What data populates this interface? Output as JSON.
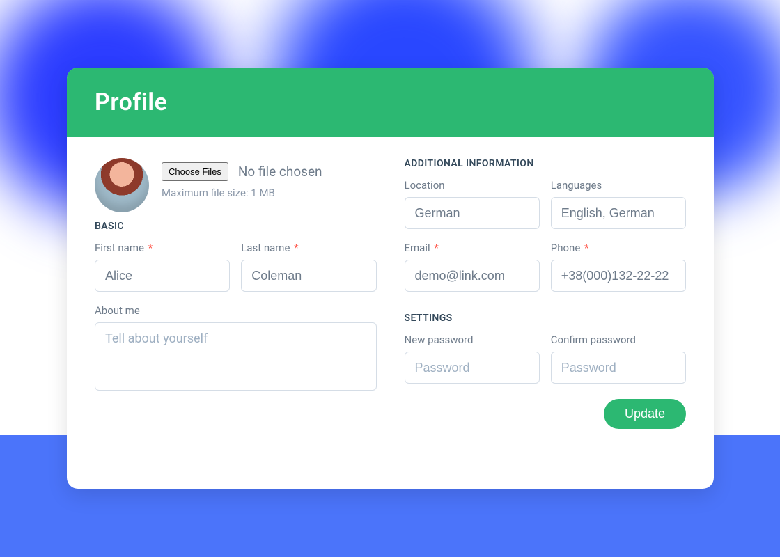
{
  "header": {
    "title": "Profile"
  },
  "avatar": {
    "choose_label": "Choose Files",
    "status": "No file chosen",
    "hint": "Maximum file size: 1 MB"
  },
  "sections": {
    "basic": "BASIC",
    "additional": "ADDITIONAL INFORMATION",
    "settings": "SETTINGS"
  },
  "fields": {
    "first_name": {
      "label": "First name",
      "required": true,
      "value": "Alice"
    },
    "last_name": {
      "label": "Last name",
      "required": true,
      "value": "Coleman"
    },
    "about": {
      "label": "About me",
      "placeholder": "Tell about yourself"
    },
    "location": {
      "label": "Location",
      "value": "German"
    },
    "languages": {
      "label": "Languages",
      "value": "English, German"
    },
    "email": {
      "label": "Email",
      "required": true,
      "value": "demo@link.com"
    },
    "phone": {
      "label": "Phone",
      "required": true,
      "value": "+38(000)132-22-22"
    },
    "new_password": {
      "label": "New password",
      "placeholder": "Password"
    },
    "confirm_password": {
      "label": "Confirm password",
      "placeholder": "Password"
    }
  },
  "required_mark": "*",
  "actions": {
    "update": "Update"
  }
}
